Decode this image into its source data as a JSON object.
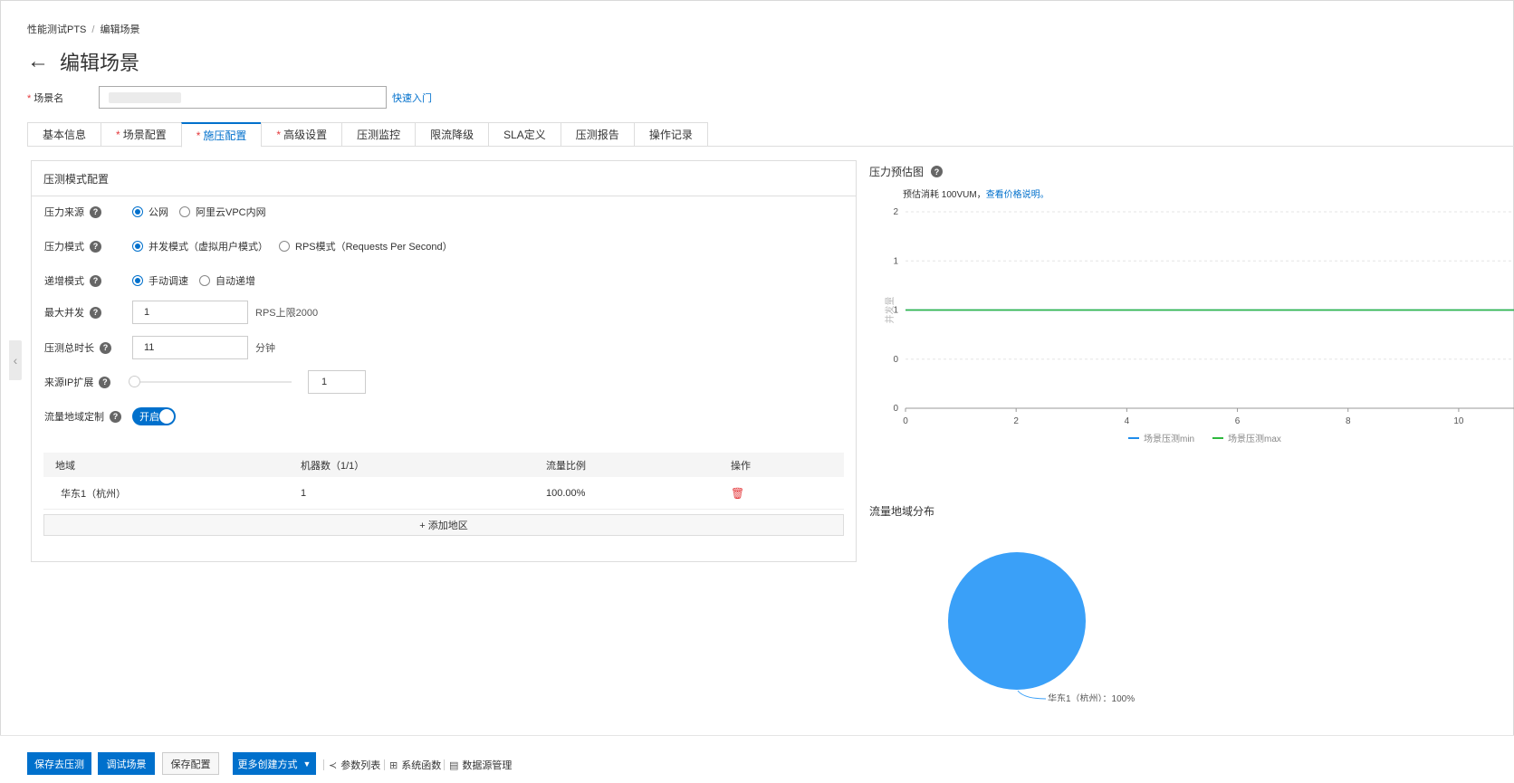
{
  "breadcrumb": {
    "root": "性能测试PTS",
    "sep": "/",
    "current": "编辑场景"
  },
  "page_title": "编辑场景",
  "scene_name": {
    "label": "场景名",
    "required_mark": "*",
    "quick_link": "快速入门"
  },
  "tabs": [
    {
      "label": "基本信息",
      "required": ""
    },
    {
      "label": "场景配置",
      "required": "*"
    },
    {
      "label": "施压配置",
      "required": "*"
    },
    {
      "label": "高级设置",
      "required": "*"
    },
    {
      "label": "压测监控",
      "required": ""
    },
    {
      "label": "限流降级",
      "required": ""
    },
    {
      "label": "SLA定义",
      "required": ""
    },
    {
      "label": "压测报告",
      "required": ""
    },
    {
      "label": "操作记录",
      "required": ""
    }
  ],
  "panel": {
    "title": "压测模式配置",
    "pressure_source": {
      "label": "压力来源",
      "opt1": "公网",
      "opt2": "阿里云VPC内网"
    },
    "pressure_mode": {
      "label": "压力模式",
      "opt1": "并发模式（虚拟用户模式）",
      "opt2": "RPS模式（Requests Per Second）"
    },
    "ramp_mode": {
      "label": "递增模式",
      "opt1": "手动调速",
      "opt2": "自动递增"
    },
    "max_concurrency": {
      "label": "最大并发",
      "value": "1",
      "hint": "RPS上限2000"
    },
    "duration": {
      "label": "压测总时长",
      "value": "11",
      "unit": "分钟"
    },
    "ip_expand": {
      "label": "来源IP扩展",
      "value": "1"
    },
    "region_custom": {
      "label": "流量地域定制",
      "switch": "开启"
    },
    "table": {
      "headers": [
        "地域",
        "机器数（1/1）",
        "流量比例",
        "操作"
      ],
      "rows": [
        {
          "region": "华东1（杭州）",
          "machines": "1",
          "ratio": "100.00%"
        }
      ],
      "add_label": "+ 添加地区"
    }
  },
  "chart": {
    "title": "压力预估图",
    "estimate_text": "预估消耗 100VUM，",
    "estimate_link": "查看价格说明。",
    "ylabel": "并发量"
  },
  "chart_data": [
    {
      "type": "line",
      "title": "压力预估图",
      "ylabel": "并发量",
      "y_tick_labels": [
        "2",
        "1",
        "1",
        "0",
        "0"
      ],
      "x_ticks": [
        0,
        2,
        4,
        6,
        8,
        10
      ],
      "xlim": [
        0,
        11
      ],
      "series": [
        {
          "name": "场景压测min",
          "color": "#1f8ceb",
          "x": [
            0,
            11
          ],
          "y": [
            1,
            1
          ]
        },
        {
          "name": "场景压测max",
          "color": "#2db83d",
          "x": [
            0,
            11
          ],
          "y": [
            1,
            1
          ]
        }
      ],
      "legend": "bottom"
    },
    {
      "type": "pie",
      "title": "流量地域分布",
      "slices": [
        {
          "label": "华东1（杭州）：100%",
          "value": 100,
          "color": "#3aa0f8"
        }
      ]
    }
  ],
  "footer": {
    "save_run": "保存去压测",
    "debug": "调试场景",
    "save_config": "保存配置",
    "more": "更多创建方式",
    "params": "参数列表",
    "functions": "系统函数",
    "datasource": "数据源管理"
  }
}
